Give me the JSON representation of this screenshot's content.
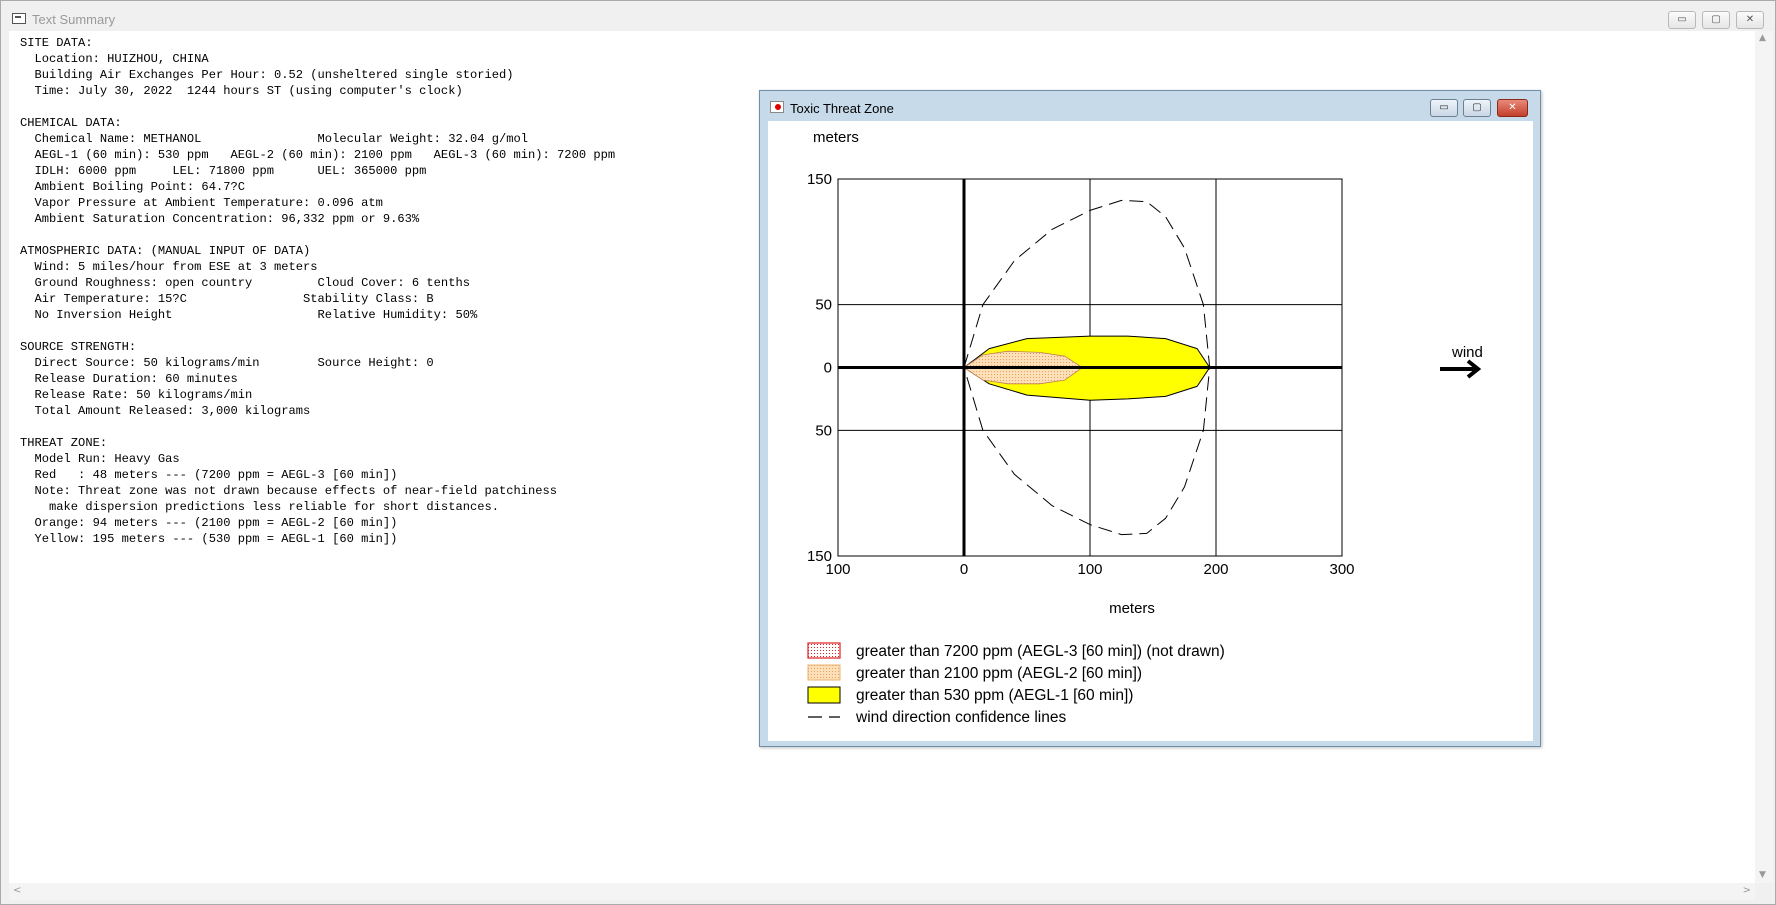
{
  "main_window": {
    "title": "Text Summary",
    "controls": {
      "minimize": "▭",
      "maximize": "▢",
      "close": "✕"
    }
  },
  "report": {
    "lines": [
      "SITE DATA:",
      "  Location: HUIZHOU, CHINA",
      "  Building Air Exchanges Per Hour: 0.52 (unsheltered single storied)",
      "  Time: July 30, 2022  1244 hours ST (using computer's clock)",
      "",
      "CHEMICAL DATA:",
      "  Chemical Name: METHANOL                Molecular Weight: 32.04 g/mol",
      "  AEGL-1 (60 min): 530 ppm   AEGL-2 (60 min): 2100 ppm   AEGL-3 (60 min): 7200 ppm",
      "  IDLH: 6000 ppm     LEL: 71800 ppm      UEL: 365000 ppm",
      "  Ambient Boiling Point: 64.7?C",
      "  Vapor Pressure at Ambient Temperature: 0.096 atm",
      "  Ambient Saturation Concentration: 96,332 ppm or 9.63%",
      "",
      "ATMOSPHERIC DATA: (MANUAL INPUT OF DATA)",
      "  Wind: 5 miles/hour from ESE at 3 meters",
      "  Ground Roughness: open country         Cloud Cover: 6 tenths",
      "  Air Temperature: 15?C                Stability Class: B",
      "  No Inversion Height                    Relative Humidity: 50%",
      "",
      "SOURCE STRENGTH:",
      "  Direct Source: 50 kilograms/min        Source Height: 0",
      "  Release Duration: 60 minutes",
      "  Release Rate: 50 kilograms/min",
      "  Total Amount Released: 3,000 kilograms",
      "",
      "THREAT ZONE:",
      "  Model Run: Heavy Gas",
      "  Red   : 48 meters --- (7200 ppm = AEGL-3 [60 min])",
      "  Note: Threat zone was not drawn because effects of near-field patchiness",
      "    make dispersion predictions less reliable for short distances.",
      "  Orange: 94 meters --- (2100 ppm = AEGL-2 [60 min])",
      "  Yellow: 195 meters --- (530 ppm = AEGL-1 [60 min])"
    ]
  },
  "threat_zone_window": {
    "title": "Toxic Threat Zone",
    "controls": {
      "minimize": "▭",
      "maximize": "▢",
      "close": "✕"
    },
    "wind_label": "wind",
    "legend": [
      {
        "label": "greater than 7200 ppm (AEGL-3 [60 min]) (not drawn)",
        "swatch": "red-dotted"
      },
      {
        "label": "greater than 2100 ppm (AEGL-2 [60 min])",
        "swatch": "orange-dotted"
      },
      {
        "label": "greater than 530 ppm (AEGL-1 [60 min])",
        "swatch": "yellow"
      },
      {
        "label": "wind direction confidence lines",
        "swatch": "dashed-line"
      }
    ],
    "colors": {
      "yellow": "#ffff00",
      "orange_fill": "#fde0b8",
      "orange_dots": "#e8a060",
      "red": "#e02020",
      "grid": "#000000"
    }
  },
  "chart_data": {
    "type": "area",
    "title": "",
    "xlabel": "meters",
    "ylabel": "meters",
    "xlim": [
      -100,
      300
    ],
    "ylim": [
      -150,
      150
    ],
    "x_ticks": [
      -100,
      0,
      100,
      200,
      300
    ],
    "y_ticks": [
      -150,
      -50,
      0,
      50,
      150
    ],
    "x_tick_labels": [
      "100",
      "0",
      "100",
      "200",
      "300"
    ],
    "y_tick_labels": [
      "150",
      "50",
      "0",
      "50",
      "150"
    ],
    "grid": true,
    "series": [
      {
        "name": "greater than 530 ppm (AEGL-1 [60 min])",
        "x": [
          0,
          20,
          50,
          100,
          130,
          160,
          185,
          195,
          185,
          160,
          130,
          100,
          50,
          20,
          0
        ],
        "y": [
          0,
          15,
          23,
          25,
          25,
          23,
          15,
          0,
          -15,
          -23,
          -25,
          -26,
          -22,
          -13,
          0
        ]
      },
      {
        "name": "greater than 2100 ppm (AEGL-2 [60 min])",
        "x": [
          0,
          15,
          35,
          60,
          80,
          94,
          80,
          60,
          35,
          15,
          0
        ],
        "y": [
          0,
          10,
          13,
          12,
          9,
          0,
          -10,
          -13,
          -13,
          -10,
          0
        ]
      },
      {
        "name": "wind direction confidence lines",
        "x": [
          0,
          15,
          40,
          70,
          100,
          125,
          145,
          160,
          175,
          190,
          195,
          190,
          175,
          160,
          145,
          125,
          100,
          70,
          40,
          15,
          0
        ],
        "y": [
          0,
          50,
          85,
          110,
          125,
          133,
          132,
          120,
          95,
          50,
          0,
          -50,
          -95,
          -120,
          -132,
          -133,
          -125,
          -110,
          -85,
          -50,
          0
        ]
      }
    ]
  }
}
